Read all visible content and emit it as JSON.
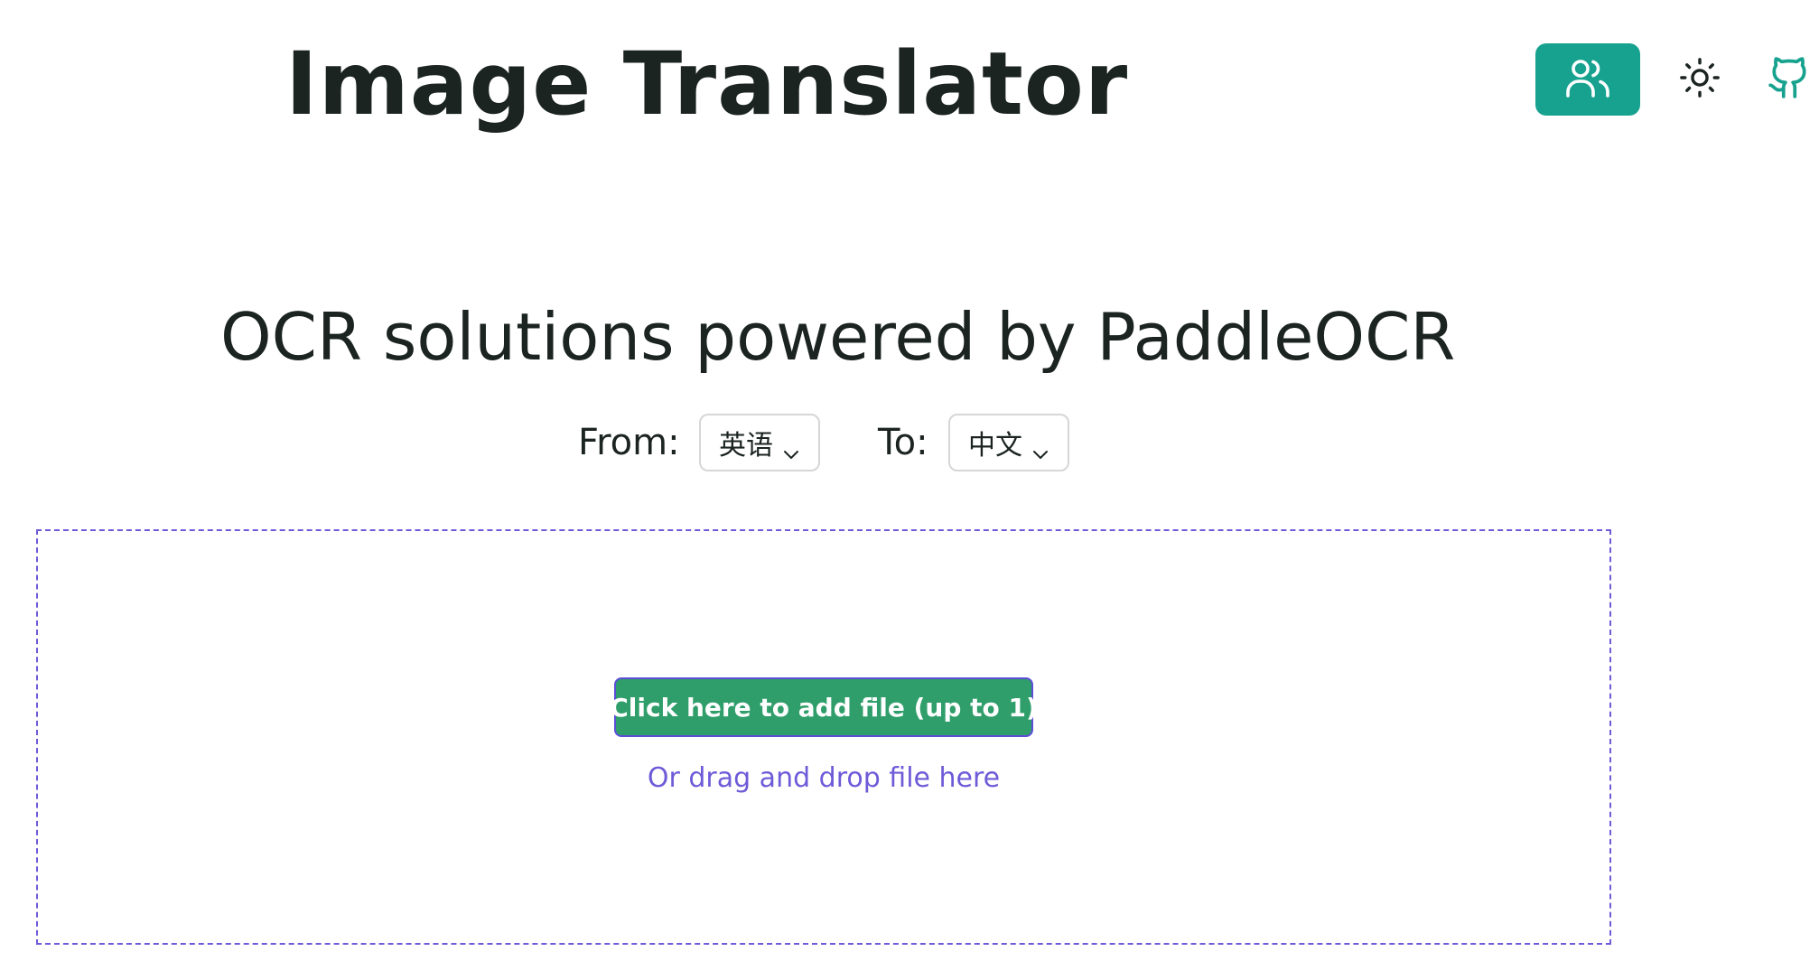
{
  "header": {
    "title": "Image Translator",
    "users_icon": "users-icon",
    "theme_icon": "sun-icon",
    "github_icon": "github-icon"
  },
  "main": {
    "subtitle": "OCR solutions powered by PaddleOCR",
    "from_label": "From:",
    "from_value": "英语",
    "to_label": "To:",
    "to_value": "中文"
  },
  "dropzone": {
    "button_label": "Click here to add file (up to 1)",
    "hint": "Or drag and drop file here"
  },
  "colors": {
    "accent": "#17a28f",
    "button_green": "#2f9e6a",
    "dropzone_border": "#6d5bd8",
    "text": "#1b2421"
  }
}
